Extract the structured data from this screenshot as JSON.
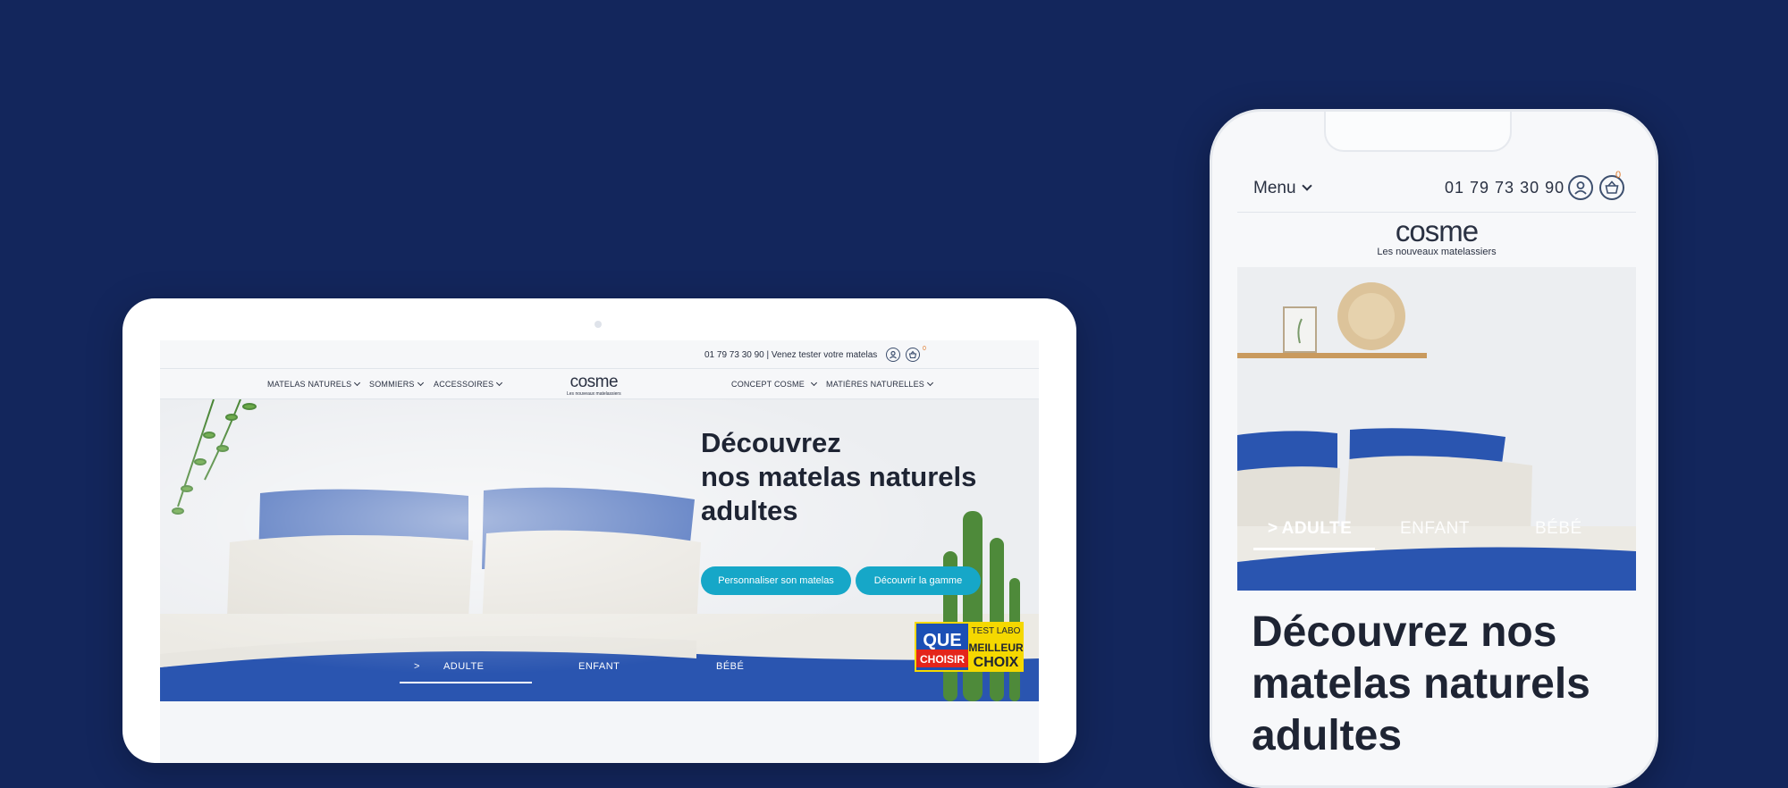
{
  "tablet": {
    "contact_text": "01 79 73 30 90 | Venez tester votre matelas",
    "cart_count": "0",
    "nav": {
      "left": [
        "MATELAS NATURELS",
        "SOMMIERS",
        "ACCESSOIRES"
      ],
      "right": [
        "CONCEPT COSME",
        "MATIÈRES NATURELLES"
      ]
    },
    "logo": {
      "name": "cosme",
      "tagline": "Les nouveaux matelassiers"
    },
    "hero": {
      "title_lines": [
        "Découvrez",
        "nos matelas naturels",
        "adultes"
      ],
      "buttons": [
        "Personnaliser son matelas",
        "Découvrir la gamme"
      ],
      "tabs": [
        "ADULTE",
        "ENFANT",
        "BÉBÉ"
      ],
      "active_tab_marker": ">",
      "badge": {
        "brand": [
          "QUE",
          "CHOISIR"
        ],
        "label": [
          "TEST LABO",
          "MEILLEUR",
          "CHOIX"
        ]
      }
    }
  },
  "phone": {
    "menu_label": "Menu",
    "phone_number": "01 79 73 30 90",
    "cart_count": "0",
    "logo": {
      "name": "cosme",
      "tagline": "Les nouveaux matelassiers"
    },
    "hero": {
      "tabs": [
        "ADULTE",
        "ENFANT",
        "BÉBÉ"
      ],
      "active_tab_marker": ">"
    },
    "title": "Découvrez nos matelas naturels adultes"
  },
  "colors": {
    "background": "#13265c",
    "accent": "#16a7c8",
    "pillow_blue": "#2a55b0",
    "text": "#1e2433",
    "badge_orange": "#e07a2c"
  }
}
